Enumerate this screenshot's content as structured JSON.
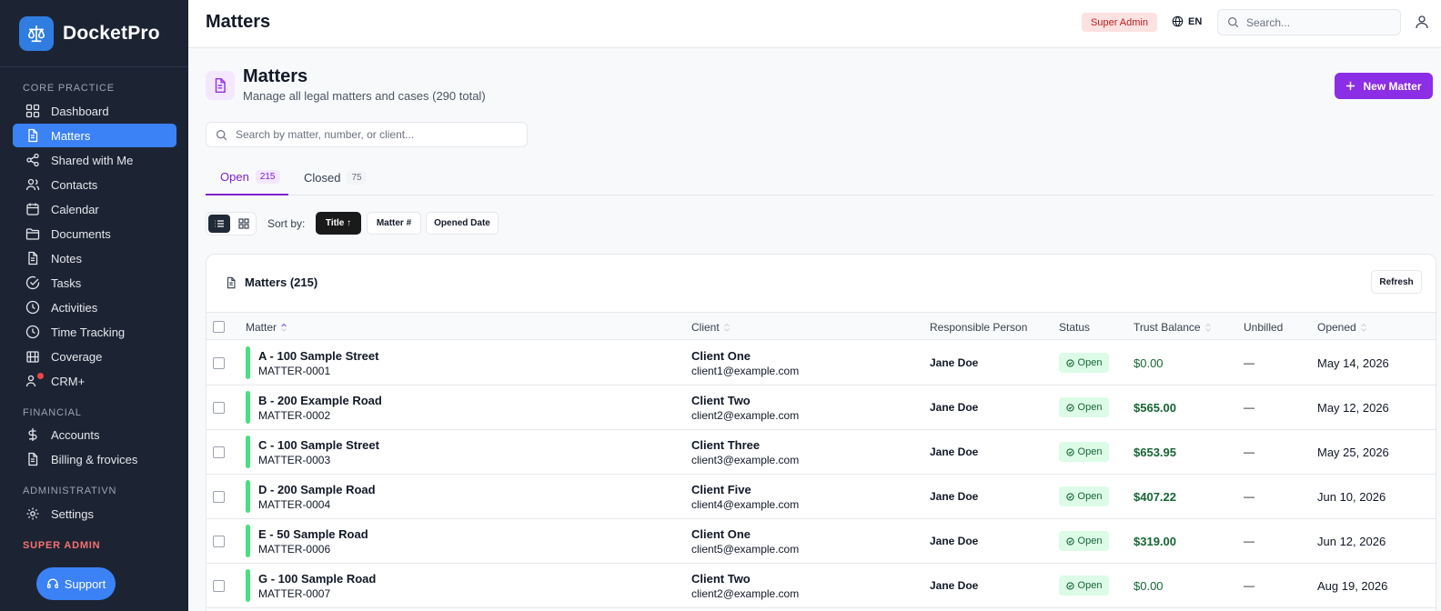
{
  "app": {
    "name": "DocketPro"
  },
  "sidebar": {
    "sections": {
      "core": "CORE PRACTICE",
      "financial": "FINANCIAL",
      "admin": "ADMINISTRATIVN",
      "super": "SUPER ADMIN"
    },
    "core_items": [
      "Dashboard",
      "Matters",
      "Shared with Me",
      "Contacts",
      "Calendar",
      "Documents",
      "Notes",
      "Tasks",
      "Activities",
      "Time Tracking",
      "Coverage",
      "CRM+"
    ],
    "financial_items": [
      "Accounts",
      "Billing & frovices"
    ],
    "admin_items": [
      "Settings"
    ],
    "support_label": "Support"
  },
  "header": {
    "title": "Matters",
    "role_badge": "Super Admin",
    "language": "EN",
    "search_placeholder": "Search..."
  },
  "page": {
    "title": "Matters",
    "subtitle": "Manage all legal matters and cases (290 total)",
    "new_button": "New Matter",
    "search_placeholder": "Search by matter, number, or client...",
    "tabs": [
      {
        "label": "Open",
        "count": "215"
      },
      {
        "label": "Closed",
        "count": "75"
      }
    ],
    "sort_label": "Sort by:",
    "sort_options": [
      "Title ↑",
      "Matter #",
      "Opened Date"
    ]
  },
  "table": {
    "title": "Matters (215)",
    "refresh_label": "Refresh",
    "columns": [
      "Matter",
      "Client",
      "Responsible Person",
      "Status",
      "Trust Balance",
      "Unbilled",
      "Opened"
    ],
    "rows": [
      {
        "title": "A - 100 Sample Street",
        "number": "MATTER-0001",
        "client": "Client One",
        "email": "client1@example.com",
        "person": "Jane Doe",
        "status": "Open",
        "trust": "$0.00",
        "unbilled": "—",
        "opened": "May 14, 2026"
      },
      {
        "title": "B - 200 Example Road",
        "number": "MATTER-0002",
        "client": "Client Two",
        "email": "client2@example.com",
        "person": "Jane Doe",
        "status": "Open",
        "trust": "$565.00",
        "unbilled": "—",
        "opened": "May 12, 2026"
      },
      {
        "title": "C - 100 Sample Street",
        "number": "MATTER-0003",
        "client": "Client Three",
        "email": "client3@example.com",
        "person": "Jane Doe",
        "status": "Open",
        "trust": "$653.95",
        "unbilled": "—",
        "opened": "May 25, 2026"
      },
      {
        "title": "D - 200 Sample Road",
        "number": "MATTER-0004",
        "client": "Client Five",
        "email": "client4@example.com",
        "person": "Jane Doe",
        "status": "Open",
        "trust": "$407.22",
        "unbilled": "—",
        "opened": "Jun 10, 2026"
      },
      {
        "title": "E - 50 Sample Road",
        "number": "MATTER-0006",
        "client": "Client One",
        "email": "client5@example.com",
        "person": "Jane Doe",
        "status": "Open",
        "trust": "$319.00",
        "unbilled": "—",
        "opened": "Jun 12, 2026"
      },
      {
        "title": "G - 100 Sample Road",
        "number": "MATTER-0007",
        "client": "Client Two",
        "email": "client2@example.com",
        "person": "Jane Doe",
        "status": "Open",
        "trust": "$0.00",
        "unbilled": "—",
        "opened": "Aug 19, 2026"
      }
    ]
  },
  "colors": {
    "sidebar_bg": "#1c2434",
    "active_nav": "#3b82f6",
    "accent_purple": "#8b2ee6",
    "status_open_bg": "#dcfce7",
    "trust_green": "#166534"
  }
}
